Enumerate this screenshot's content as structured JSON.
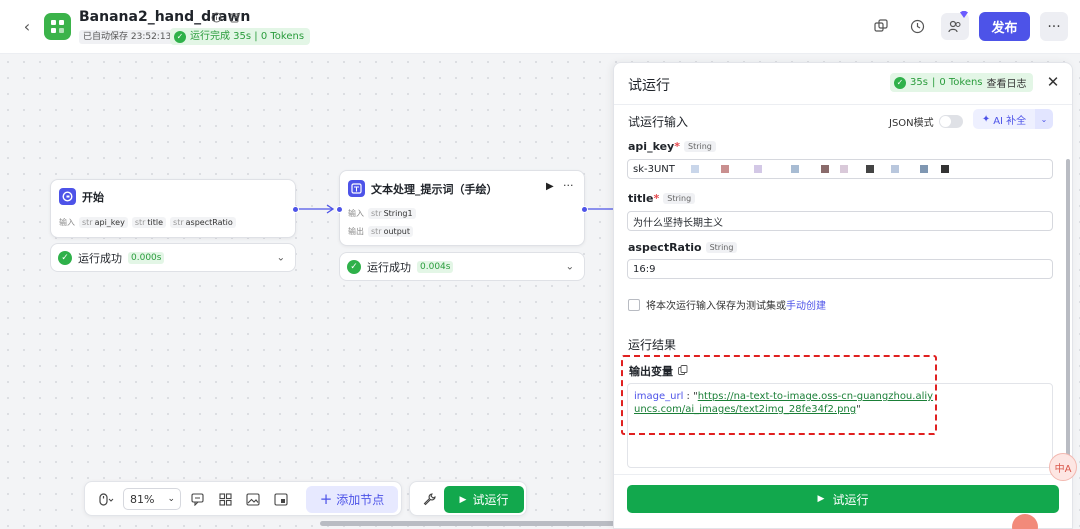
{
  "header": {
    "app_title": "Banana2_hand_drawn",
    "autosave": "已自动保存 23:52:13",
    "run_status": "运行完成 35s | 0 Tokens",
    "publish_label": "发布",
    "more_label": "···"
  },
  "canvas": {
    "start_node": {
      "title": "开始",
      "input_label": "输入",
      "inputs": [
        "api_key",
        "title",
        "aspectRatio"
      ],
      "type_prefix": "str",
      "status": "运行成功",
      "time": "0.000s"
    },
    "text_node": {
      "title": "文本处理_提示词（手绘）",
      "input_label": "输入",
      "output_label": "输出",
      "input_var": "String1",
      "output_var": "output",
      "type_prefix": "str",
      "status": "运行成功",
      "time": "0.004s"
    },
    "toolbar": {
      "zoom": "81%",
      "add_node_label": "添加节点",
      "test_run_label": "试运行"
    }
  },
  "panel": {
    "title": "试运行",
    "status_time": "35s",
    "status_sep": "|",
    "status_tokens": "0 Tokens",
    "view_logs_label": "查看日志",
    "input_section_title": "试运行输入",
    "json_mode_label": "JSON模式",
    "ai_fill_label": "AI 补全",
    "fields": [
      {
        "label": "api_key",
        "required": "*",
        "type": "String",
        "value": "sk-3UNT"
      },
      {
        "label": "title",
        "required": "*",
        "type": "String",
        "value": "为什么坚持长期主义"
      },
      {
        "label": "aspectRatio",
        "required": "",
        "type": "String",
        "value": "16:9"
      }
    ],
    "save_text": "将本次运行输入保存为测试集或",
    "save_link": "手动创建",
    "result_section_title": "运行结果",
    "output_var_label": "输出变量",
    "output_key": "image_url",
    "output_colon": " : ",
    "output_quote_open": "\"",
    "output_url": "https://na-text-to-image.oss-cn-guangzhou.aliyuncs.com/ai_images/text2img_28fe34f2.png",
    "output_quote_close": "\"",
    "run_button_label": "试运行"
  },
  "side_bubble_label": "中A",
  "colors": {
    "brand": "#4d53e8",
    "success": "#12a84d",
    "success_bg": "#e3f6e6",
    "highlight": "#e02020"
  }
}
